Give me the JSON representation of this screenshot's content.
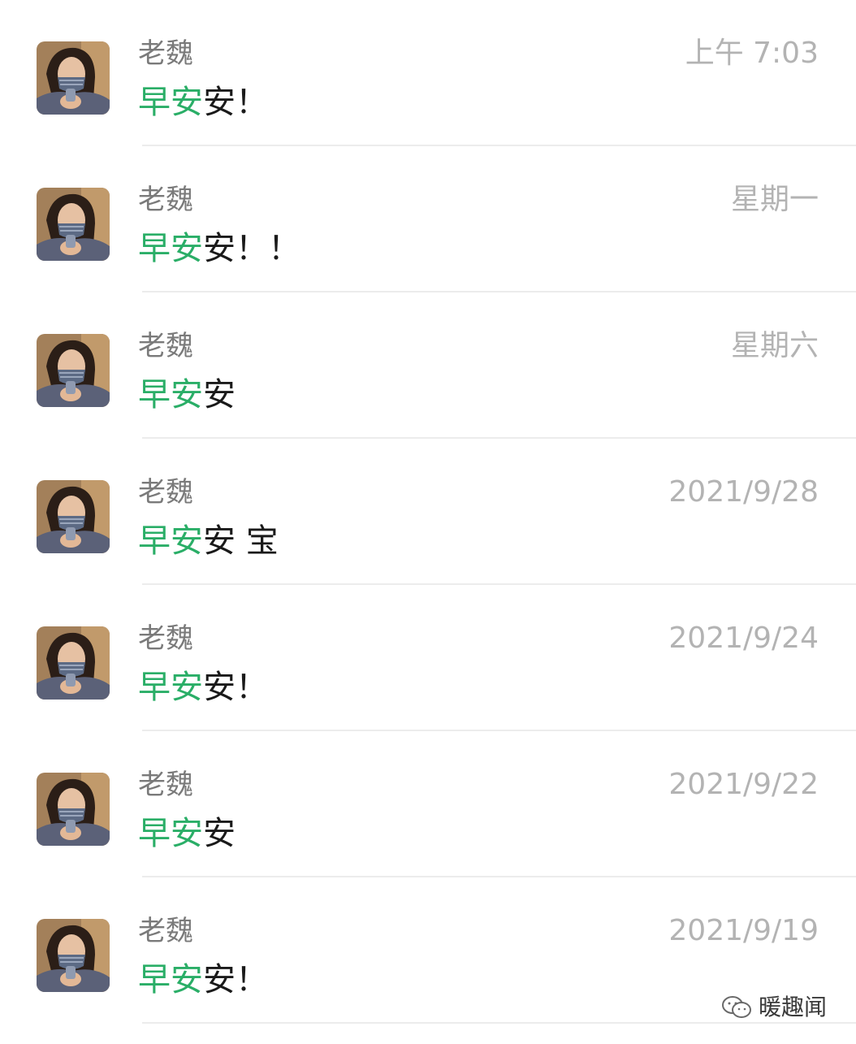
{
  "chats": [
    {
      "name": "老魏",
      "time": "上午 7:03",
      "message_highlight": "早安",
      "message_rest": "安！"
    },
    {
      "name": "老魏",
      "time": "星期一",
      "message_highlight": "早安",
      "message_rest": "安！！"
    },
    {
      "name": "老魏",
      "time": "星期六",
      "message_highlight": "早安",
      "message_rest": "安"
    },
    {
      "name": "老魏",
      "time": "2021/9/28",
      "message_highlight": "早安",
      "message_rest": "安 宝"
    },
    {
      "name": "老魏",
      "time": "2021/9/24",
      "message_highlight": "早安",
      "message_rest": "安！"
    },
    {
      "name": "老魏",
      "time": "2021/9/22",
      "message_highlight": "早安",
      "message_rest": "安"
    },
    {
      "name": "老魏",
      "time": "2021/9/19",
      "message_highlight": "早安",
      "message_rest": "安！"
    }
  ],
  "watermark": {
    "text": "暖趣闻",
    "icon": "wechat-official-account-icon"
  },
  "colors": {
    "highlight": "#2aae67",
    "name": "#7a7a7a",
    "time": "#b3b3b3",
    "message": "#1a1a1a",
    "divider": "#ececec"
  }
}
